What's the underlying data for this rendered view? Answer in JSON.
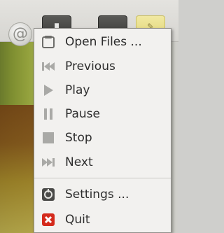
{
  "menu": {
    "items": [
      {
        "label": "Open Files ...",
        "icon": "folder-icon"
      },
      {
        "label": "Previous",
        "icon": "previous-icon"
      },
      {
        "label": "Play",
        "icon": "play-icon"
      },
      {
        "label": "Pause",
        "icon": "pause-icon"
      },
      {
        "label": "Stop",
        "icon": "stop-icon"
      },
      {
        "label": "Next",
        "icon": "next-icon"
      },
      {
        "label": "Settings ...",
        "icon": "settings-icon"
      },
      {
        "label": "Quit",
        "icon": "quit-icon"
      }
    ]
  },
  "colors": {
    "quit": "#d42a1c",
    "menu_bg": "#f2f1ef",
    "icon_gray": "#a9a9a6"
  }
}
